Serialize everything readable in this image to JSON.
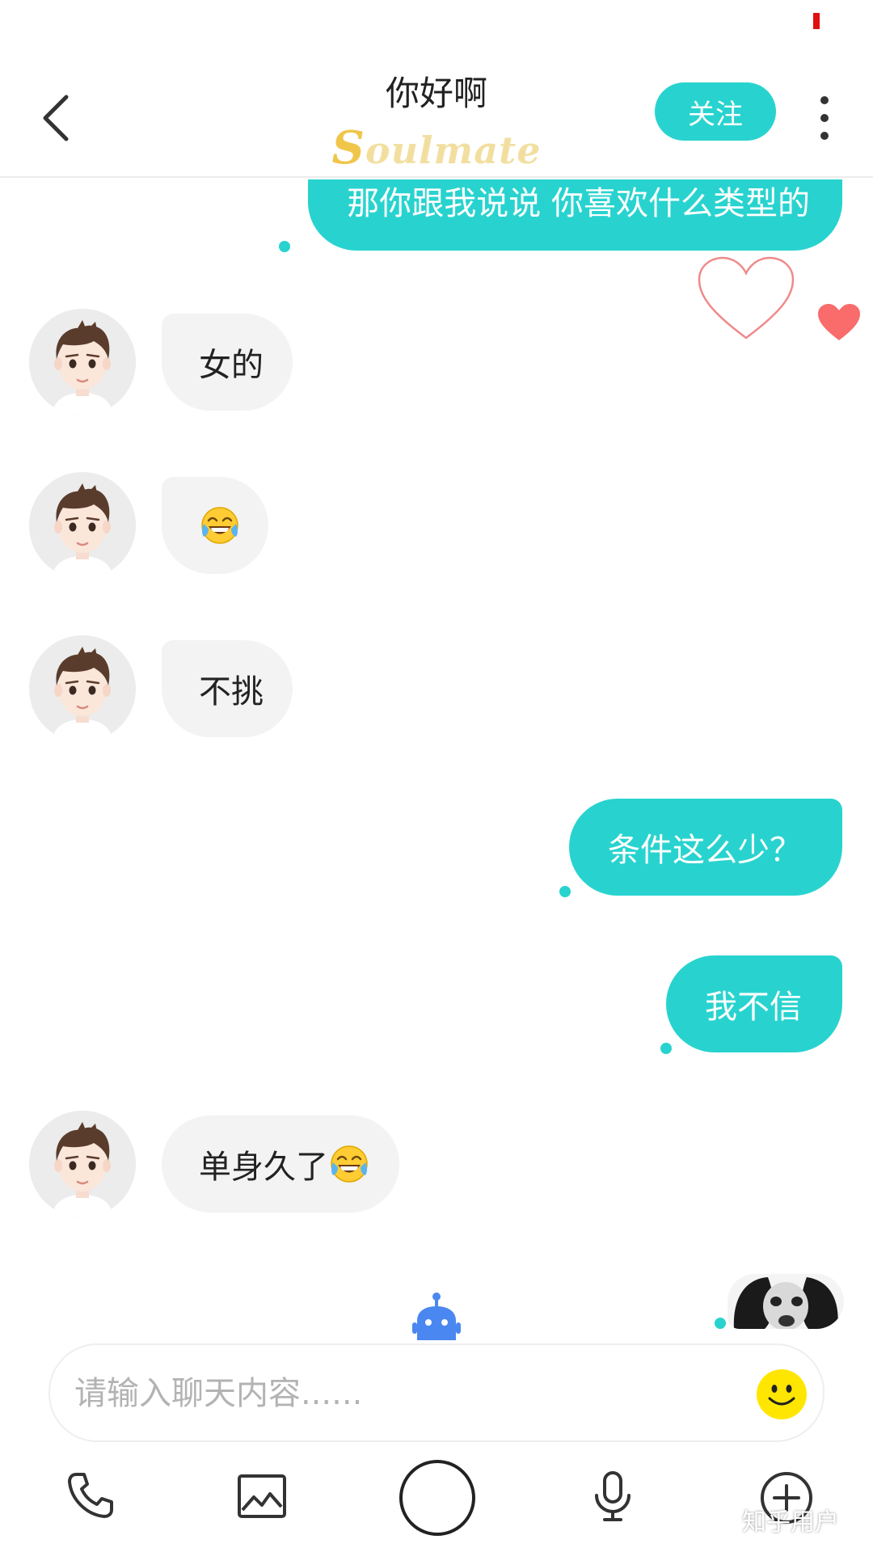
{
  "header": {
    "title": "你好啊",
    "logo_first": "S",
    "logo_rest": "oulmate",
    "follow_label": "关注"
  },
  "messages": [
    {
      "side": "out",
      "text": "那你跟我说说 你喜欢什么类型的"
    },
    {
      "side": "in",
      "text": "女的"
    },
    {
      "side": "in",
      "emoji": "tears-of-joy-emoji"
    },
    {
      "side": "in",
      "text": "不挑"
    },
    {
      "side": "out",
      "text": "条件这么少？"
    },
    {
      "side": "out",
      "text": "我不信"
    },
    {
      "side": "in",
      "text": "单身久了",
      "emoji": "tears-of-joy-emoji"
    }
  ],
  "input": {
    "placeholder": "请输入聊天内容......"
  },
  "toolbar": [
    "phone-icon",
    "image-icon",
    "capture-button",
    "microphone-icon",
    "plus-circle-icon"
  ],
  "watermark": "知乎用户",
  "colors": {
    "accent": "#28d3cf",
    "incoming_bubble": "#f3f3f3",
    "like_heart": "#fa6b6b",
    "outline_heart": "#ef8a8a",
    "logo": "#f0c64a",
    "robot": "#4b87f0",
    "status_mark": "#e01010"
  }
}
